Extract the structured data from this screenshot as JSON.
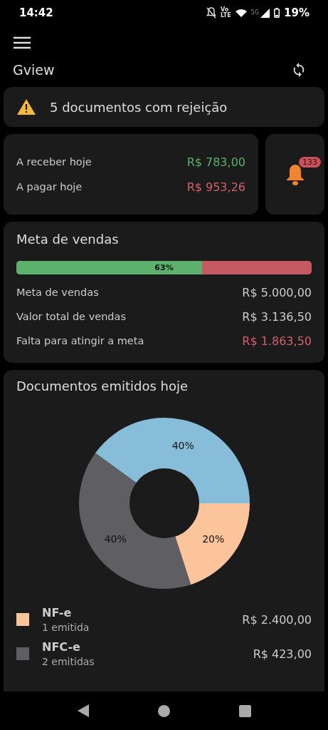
{
  "status_bar": {
    "time": "14:42",
    "volte_top": "Vo",
    "volte_bottom": "LTE",
    "network": "5G",
    "battery": "19%"
  },
  "app_bar": {
    "title": "Gview"
  },
  "alert": {
    "text": "5 documentos com rejeição"
  },
  "today": {
    "rows": [
      {
        "label": "A receber hoje",
        "value": "R$ 783,00",
        "color": "#5ab06a"
      },
      {
        "label": "A pagar hoje",
        "value": "R$ 953,26",
        "color": "#d2616a"
      }
    ]
  },
  "notifications": {
    "count": "133"
  },
  "sales_goal": {
    "title": "Meta de vendas",
    "progress": {
      "level": 0.63,
      "label": "63%"
    },
    "rows": [
      {
        "label": "Meta de vendas",
        "value": "R$ 5.000,00",
        "color": "#cccccc"
      },
      {
        "label": "Valor total de vendas",
        "value": "R$ 3.136,50",
        "color": "#cccccc"
      },
      {
        "label": "Falta para atingir a meta",
        "value": "R$ 1.863,50",
        "color": "#d2616a"
      }
    ]
  },
  "documents": {
    "title": "Documentos emitidos hoje",
    "chart_data": {
      "type": "donut",
      "values": [
        40,
        20,
        40
      ],
      "colors": [
        "#88bdd9",
        "#fbc49b",
        "#5f5e62"
      ],
      "value_labels": [
        "40%",
        "20%",
        "40%"
      ]
    },
    "legend": [
      {
        "name": "NF-e",
        "count": "1 emitida",
        "value": "R$ 2.400,00",
        "color": "#fbc49b"
      },
      {
        "name": "NFC-e",
        "count": "2 emitidas",
        "value": "R$ 423,00",
        "color": "#5f5e62"
      }
    ]
  }
}
